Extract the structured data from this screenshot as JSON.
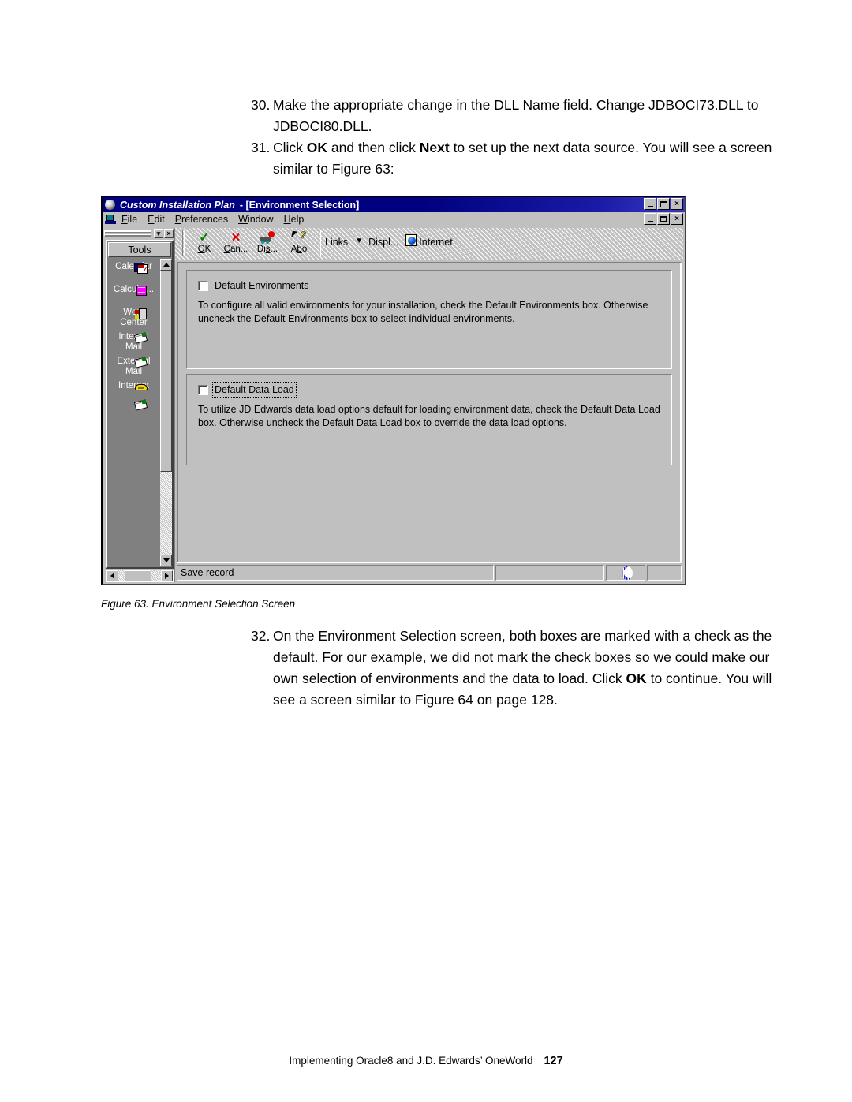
{
  "document": {
    "steps": [
      {
        "id": "step30",
        "number": "30.",
        "text": "Make the appropriate change in the DLL Name field. Change JDBOCI73.DLL to JDBOCI80.DLL."
      },
      {
        "id": "step31",
        "number": "31.",
        "text_before": "Click ",
        "bold1": "OK",
        "text_mid": " and then click ",
        "bold2": "Next",
        "text_after": " to set up the next data source. You will see a screen similar to Figure 63:"
      },
      {
        "id": "step32",
        "number": "32.",
        "text_before": "On the Environment Selection screen, both boxes are marked with a check as the default. For our example, we did not mark the check boxes so we could make our own selection of environments and the data to load. Click ",
        "bold1": "OK",
        "text_after": " to continue. You will see a screen similar to Figure 64 on page 128."
      }
    ],
    "figure_caption": "Figure 63.  Environment Selection Screen",
    "footer": {
      "book_title": "Implementing Oracle8 and J.D. Edwards’ OneWorld",
      "page_number": "127"
    }
  },
  "screenshot": {
    "titlebar": {
      "app_name": "Custom Installation Plan",
      "separator": "- [Environment Selection]",
      "buttons": {
        "minimize": "_",
        "maximize": "□",
        "close": "×"
      }
    },
    "mdi_buttons": {
      "minimize": "_",
      "restore": "❐",
      "close": "×"
    },
    "menubar": [
      {
        "label": "File",
        "accel": "F"
      },
      {
        "label": "Edit",
        "accel": "E"
      },
      {
        "label": "Preferences",
        "accel": "P"
      },
      {
        "label": "Window",
        "accel": "W"
      },
      {
        "label": "Help",
        "accel": "H"
      }
    ],
    "toolbar": {
      "buttons": [
        {
          "label": "OK",
          "accel": "O",
          "icon": "green-check-icon"
        },
        {
          "label": "Can...",
          "accel": "C",
          "icon": "red-x-icon"
        },
        {
          "label": "Dis...",
          "accel": "s",
          "icon": "display-cart-icon"
        },
        {
          "label": "Abo",
          "accel": "b",
          "icon": "arrow-question-icon"
        }
      ],
      "links_label": "Links",
      "display_label": "Displ...",
      "internet_label": "Internet",
      "caret": "▼"
    },
    "tools_panel": {
      "header": "Tools",
      "items": [
        {
          "label": "Calendar",
          "icon": "calendar-icon"
        },
        {
          "label": "Calculat...",
          "icon": "calculator-icon"
        },
        {
          "label": "Work\nCenter",
          "icon": "work-center-icon"
        },
        {
          "label": "Internal\nMail",
          "icon": "internal-mail-icon"
        },
        {
          "label": "External\nMail",
          "icon": "external-mail-icon"
        },
        {
          "label": "Internet",
          "icon": "phone-icon"
        },
        {
          "label": "",
          "icon": "mail-icon"
        }
      ],
      "close_btn": "×",
      "dropdown_btn": "▾"
    },
    "form": {
      "group1": {
        "checkbox_label": "Default Environments",
        "checked": false,
        "description": "To configure all valid environments for your installation, check the Default Environments box.  Otherwise uncheck the Default Environments box to select individual environments."
      },
      "group2": {
        "checkbox_label": "Default Data Load",
        "checked": false,
        "focused": true,
        "description": "To utilize JD Edwards data load options default for loading environment data, check the Default Data Load box.  Otherwise uncheck the Default Data Load box to override the data load options."
      }
    },
    "statusbar": {
      "message": "Save record",
      "globe_icon": "globe-icon"
    },
    "colors": {
      "titlebar": "#000080",
      "face": "#c0c0c0",
      "tools_bg": "#808080",
      "check_green": "#008000",
      "x_red": "#e00000"
    }
  }
}
